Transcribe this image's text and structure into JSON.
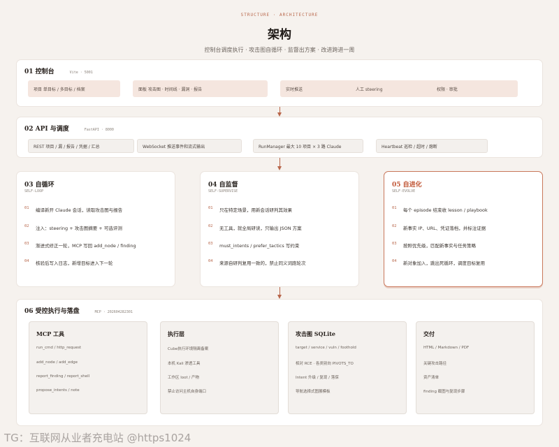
{
  "header": {
    "eyebrow": "STRUCTURE · ARCHITECTURE",
    "title": "架构",
    "subtitle": "控制台调度执行 · 攻击图自循环 · 监督出方案 · 改进跨进一周"
  },
  "sec01": {
    "title": "01 控制台",
    "tag": "Vite · 5001",
    "pill1": "项目 单目标 / 多目标 / 档案",
    "pill2": "面板 攻击图 · 时间线 · 漏洞 · 报告",
    "pill3": {
      "a": "实时推送",
      "b": "人工 steering",
      "c": "权限 · 审批"
    }
  },
  "sec02": {
    "title": "02 API 与调度",
    "tag": "FastAPI · 8000",
    "pills": [
      "REST 项目 / 漏 / 报告 / 凭据 / 汇总",
      "WebSocket 推送事件和流式输出",
      "RunManager 最大 10 项目 × 3 路 Claude",
      "Heartbeat 巡检 / 超时 / 熔断"
    ]
  },
  "sec03": {
    "title": "03 自循环",
    "tag": "SELF-LOOP",
    "steps": [
      {
        "n": "01",
        "t": "编译新开 Claude 会话，读取攻击图与报告"
      },
      {
        "n": "02",
        "t": "注入：steering + 攻击图摘要 + 可选评测"
      },
      {
        "n": "03",
        "t": "渐进式修正一轮，MCP 写回 add_node / finding"
      },
      {
        "n": "04",
        "t": "核验后写入日志，新增目标进入下一轮"
      }
    ]
  },
  "sec04": {
    "title": "04 自监督",
    "tag": "SELF-SUPERVISE",
    "steps": [
      {
        "n": "01",
        "t": "只在特定场景，用新会话研判其效果"
      },
      {
        "n": "02",
        "t": "无工具，就全局研读，只输出 JSON 方案"
      },
      {
        "n": "03",
        "t": "must_intents / prefer_tactics 写约束"
      },
      {
        "n": "04",
        "t": "来源自研判复用一致的，禁止同义词跑轮次"
      }
    ]
  },
  "sec05": {
    "title": "05 自进化",
    "tag": "SELF-EVOLVE",
    "steps": [
      {
        "n": "01",
        "t": "每个 episode 结束收 lesson / playbook"
      },
      {
        "n": "02",
        "t": "新事实 IP、URL、凭证落档，并标注证据"
      },
      {
        "n": "03",
        "t": "按照优先级，匹配新事实与任务策略"
      },
      {
        "n": "04",
        "t": "新对象加入，跳出死循环，调度目标复用"
      }
    ]
  },
  "sec06": {
    "title": "06 受控执行与落盘",
    "tag": "MCP · 202604282301",
    "tools": [
      {
        "title": "MCP 工具",
        "items": [
          "run_cmd / http_request",
          "add_node / add_edge",
          "report_finding / report_shell",
          "propose_intents / note"
        ]
      },
      {
        "title": "执行层",
        "items": [
          "Cube执行环境隔离备案",
          "本机 Kali 渗透工具",
          "工作区 loot / 产物",
          "禁止访问主机自身端口"
        ]
      },
      {
        "title": "攻击图 SQLite",
        "items": [
          "target / service / vuln / foothold",
          "相对 RCE · 各类别向 PIVOTS_TO",
          "Intent 升级 / 复现 / 落保",
          "导航选择式图展模板"
        ]
      },
      {
        "title": "交付",
        "items": [
          "HTML / Markdown / PDF",
          "关键攻击路径",
          "资产清单",
          "finding 截图与复现步骤"
        ]
      }
    ]
  },
  "footer": "TG：互联网从业者充电站 @https1024",
  "colors": {
    "accent": "#b8664a",
    "pill": "#f5e6df",
    "background": "#f6f2ee"
  }
}
